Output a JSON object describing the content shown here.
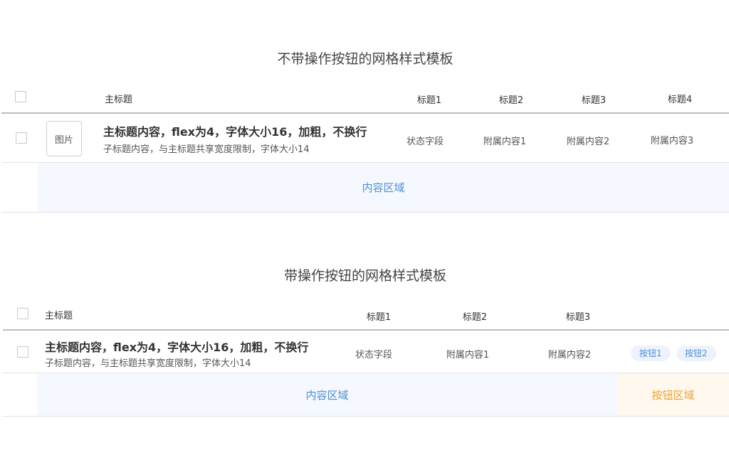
{
  "section1": {
    "title": "不带操作按钮的网格样式模板",
    "header": {
      "main": "主标题",
      "col1": "标题1",
      "col2": "标题2",
      "col3": "标题3",
      "col4": "标题4"
    },
    "row": {
      "image_label": "图片",
      "main_title": "主标题内容，flex为4，字体大小16，加粗，不换行",
      "sub_title": "子标题内容，与主标题共享宽度限制，字体大小14",
      "col1": "状态字段",
      "col2": "附属内容1",
      "col3": "附属内容2",
      "col4": "附属内容3"
    },
    "content_area": "内容区域"
  },
  "section2": {
    "title": "带操作按钮的网格样式模板",
    "header": {
      "main": "主标题",
      "col1": "标题1",
      "col2": "标题2",
      "col3": "标题3"
    },
    "row": {
      "main_title": "主标题内容，flex为4，字体大小16，加粗，不换行",
      "sub_title": "子标题内容，与主标题共享宽度限制，字体大小14",
      "col1": "状态字段",
      "col2": "附属内容1",
      "col3": "附属内容2",
      "button1": "按钮1",
      "button2": "按钮2"
    },
    "content_area": "内容区域",
    "button_area": "按钮区域"
  },
  "colors": {
    "content_bg": "#f5f8fe",
    "content_text": "#4d8fd6",
    "button_area_bg": "#fef8ee",
    "button_area_text": "#f0a32a",
    "pill_bg": "#eef3fb"
  }
}
